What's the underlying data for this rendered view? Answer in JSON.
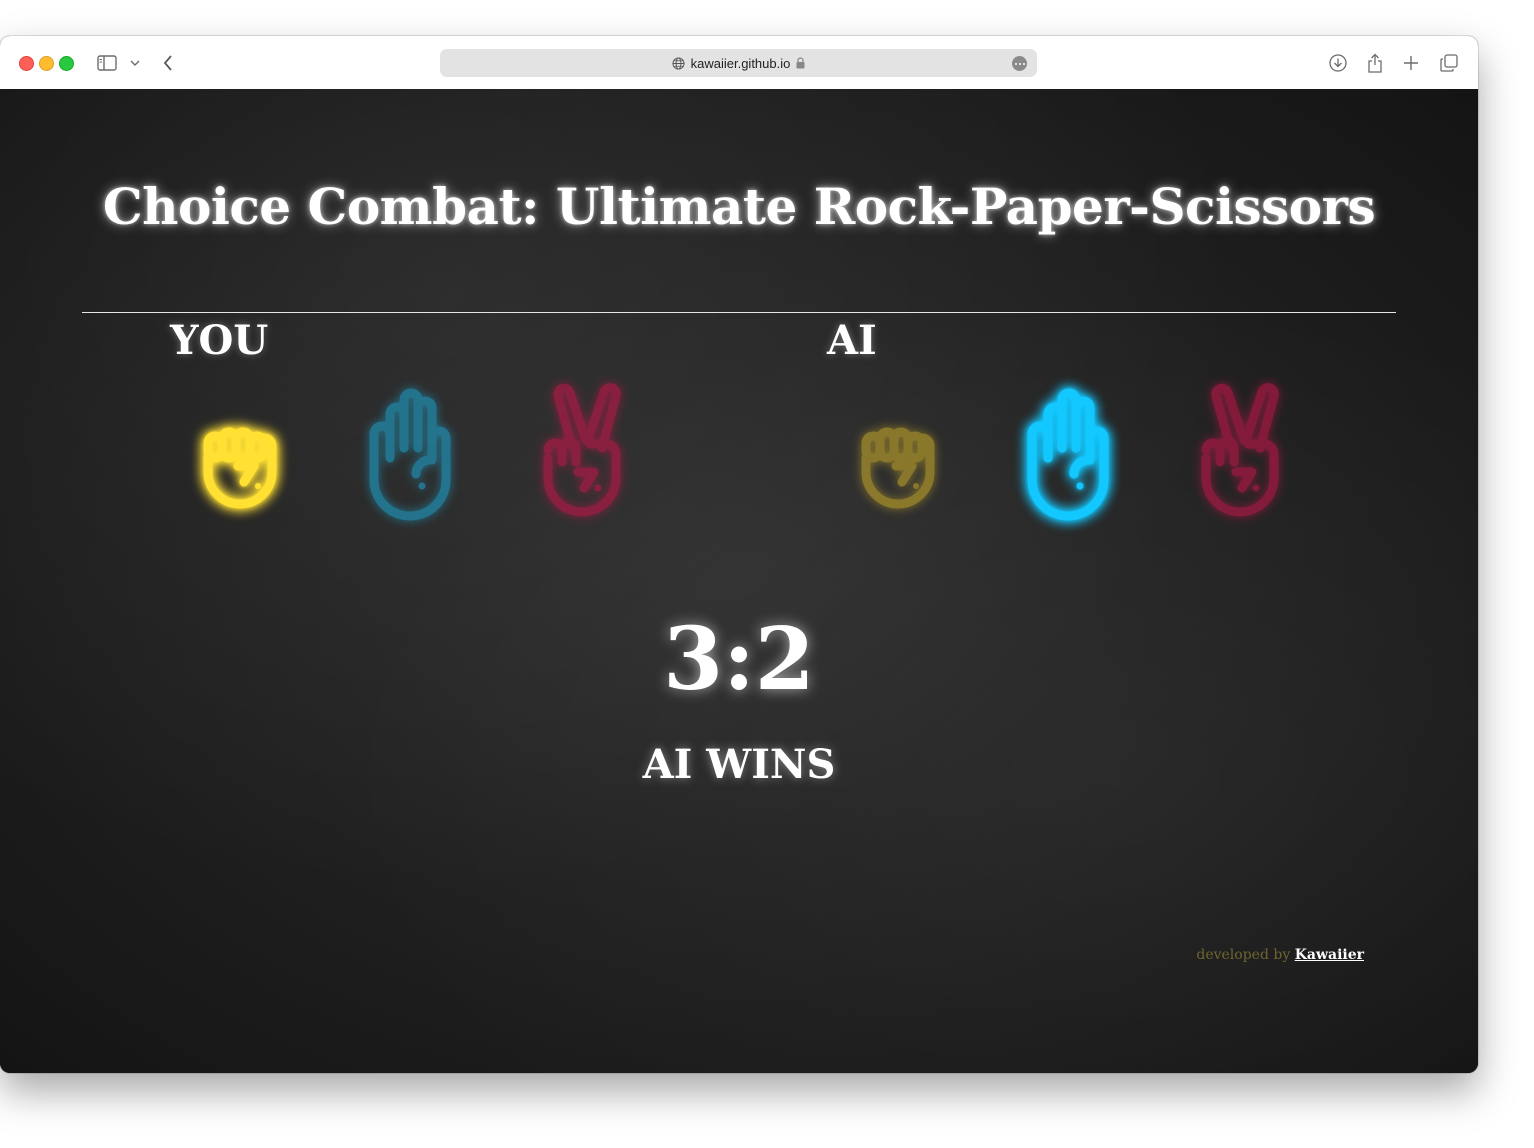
{
  "browser": {
    "url": "kawaiier.github.io"
  },
  "page": {
    "title": "Choice Combat: Ultimate Rock-Paper-Scissors",
    "score": "3:2",
    "result": "AI WINS",
    "credit_prefix": "developed by",
    "credit_link": "Kawaiier"
  },
  "players": {
    "you": {
      "label": "YOU",
      "choices": [
        {
          "name": "rock",
          "icon": "fist-icon",
          "color": "#ffe033",
          "selected": true
        },
        {
          "name": "paper",
          "icon": "open-hand-icon",
          "color": "#1e9fc8",
          "selected": false
        },
        {
          "name": "scissors",
          "icon": "peace-hand-icon",
          "color": "#c0174a",
          "selected": false
        }
      ]
    },
    "ai": {
      "label": "AI",
      "choices": [
        {
          "name": "rock",
          "icon": "fist-icon",
          "color": "#c2a52a",
          "selected": false
        },
        {
          "name": "paper",
          "icon": "open-hand-icon",
          "color": "#12c8ff",
          "selected": true
        },
        {
          "name": "scissors",
          "icon": "peace-hand-icon",
          "color": "#c0174a",
          "selected": false
        }
      ]
    }
  }
}
